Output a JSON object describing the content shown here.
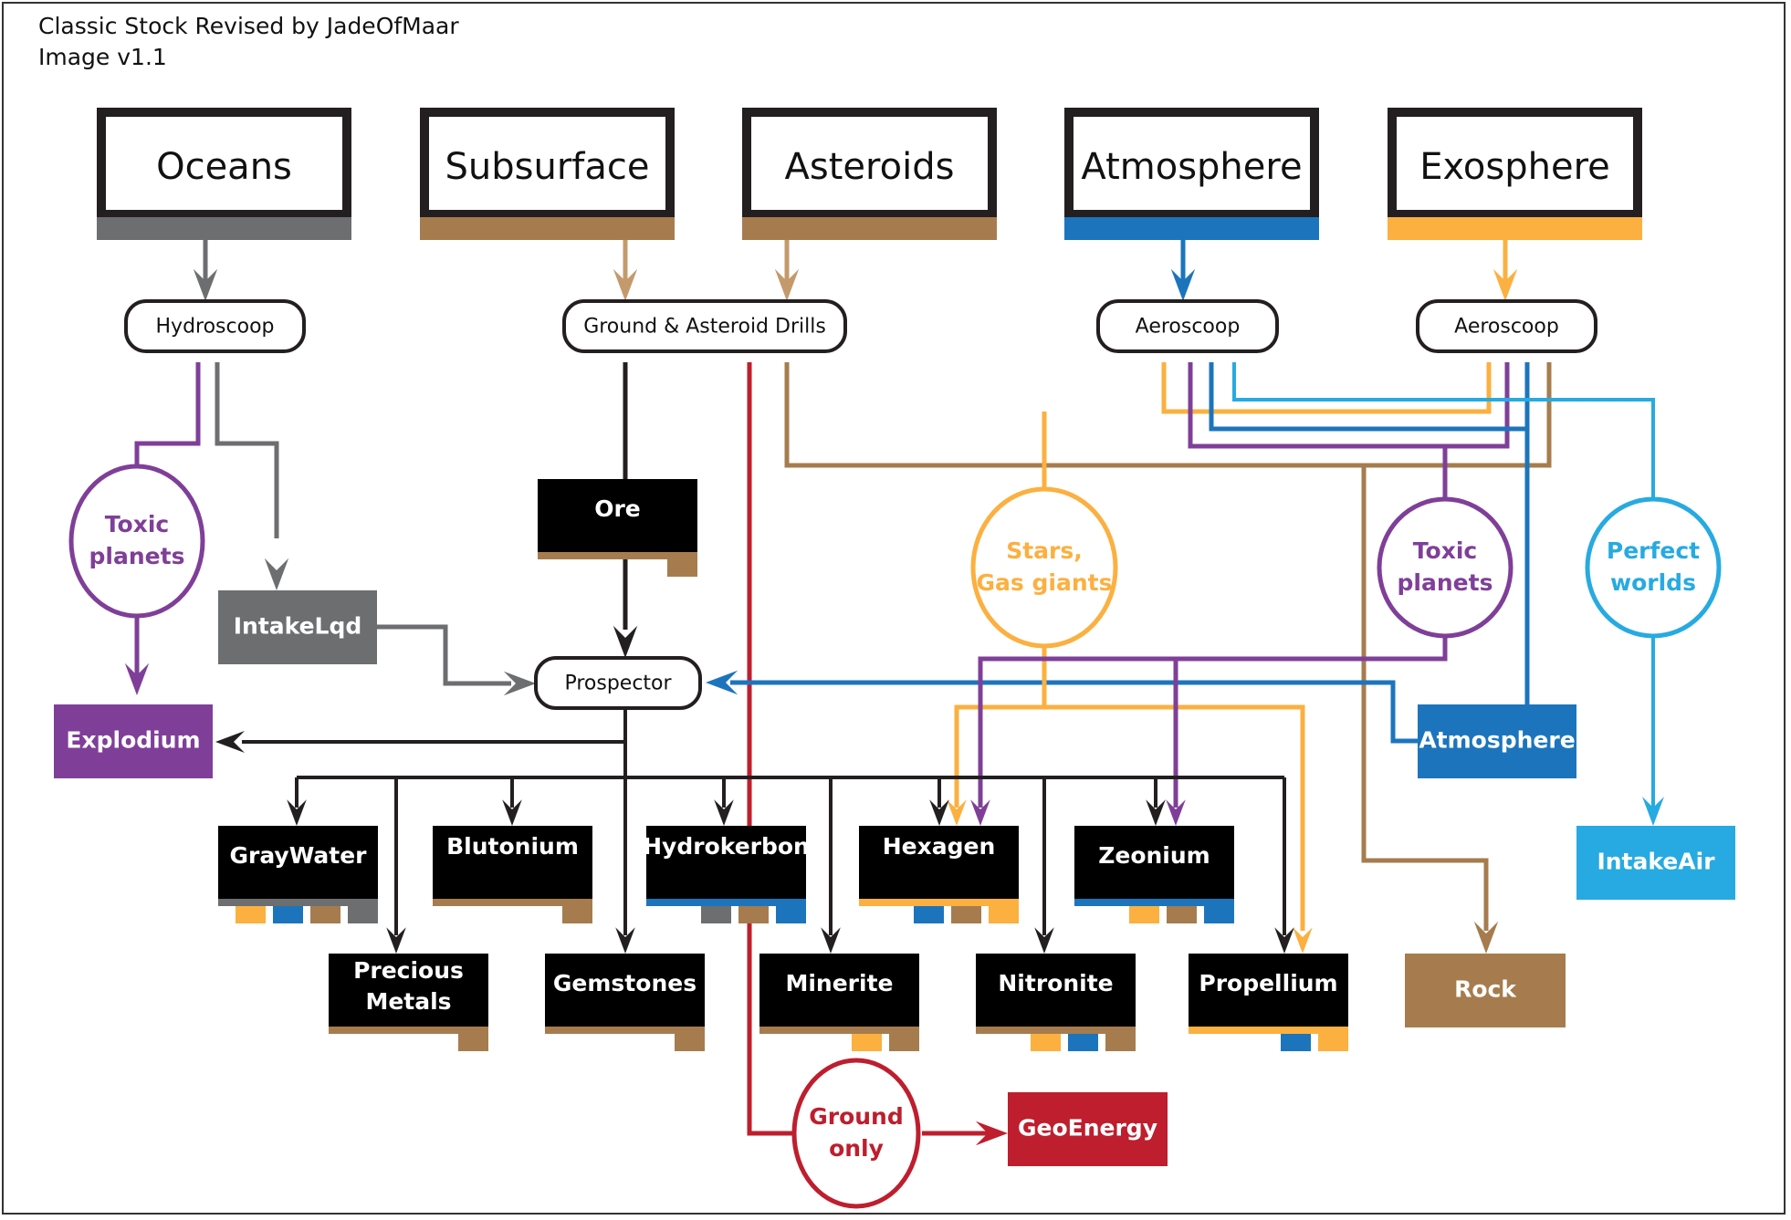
{
  "header": {
    "title": "Classic Stock Revised by JadeOfMaar",
    "version": "Image v1.1"
  },
  "colors": {
    "black": "#231f20",
    "gray": "#6d6e70",
    "brown": "#a67c4e",
    "arrow_brown": "#c49a6c",
    "blue": "#1c75bc",
    "orange": "#fbb040",
    "purple": "#7f3f98",
    "lightblue": "#27aae1",
    "red": "#be1e2d"
  },
  "sources": [
    {
      "id": "oceans",
      "label": "Oceans",
      "color": "gray"
    },
    {
      "id": "subsurface",
      "label": "Subsurface",
      "color": "brown"
    },
    {
      "id": "asteroids",
      "label": "Asteroids",
      "color": "brown"
    },
    {
      "id": "atmosphere",
      "label": "Atmosphere",
      "color": "blue"
    },
    {
      "id": "exosphere",
      "label": "Exosphere",
      "color": "orange"
    }
  ],
  "harvesters": [
    {
      "id": "hydroscoop",
      "label": "Hydroscoop"
    },
    {
      "id": "drills",
      "label": "Ground & Asteroid Drills"
    },
    {
      "id": "aeroscoop1",
      "label": "Aeroscoop"
    },
    {
      "id": "aeroscoop2",
      "label": "Aeroscoop"
    },
    {
      "id": "prospector",
      "label": "Prospector"
    }
  ],
  "conditions": [
    {
      "id": "toxic_left",
      "lines": [
        "Toxic",
        "planets"
      ],
      "color": "purple"
    },
    {
      "id": "stars",
      "lines": [
        "Stars,",
        "Gas giants"
      ],
      "color": "orange"
    },
    {
      "id": "toxic_right",
      "lines": [
        "Toxic",
        "planets"
      ],
      "color": "purple"
    },
    {
      "id": "perfect",
      "lines": [
        "Perfect",
        "worlds"
      ],
      "color": "lightblue"
    },
    {
      "id": "ground_only",
      "lines": [
        "Ground",
        "only"
      ],
      "color": "red"
    }
  ],
  "solid_resources": [
    {
      "id": "intakelqd",
      "label": "IntakeLqd",
      "color": "gray"
    },
    {
      "id": "explodium",
      "label": "Explodium",
      "color": "purple"
    },
    {
      "id": "atmosphere_res",
      "label": "Atmosphere",
      "color": "blue"
    },
    {
      "id": "intakeair",
      "label": "IntakeAir",
      "color": "lightblue"
    },
    {
      "id": "rock",
      "label": "Rock",
      "color": "brown"
    },
    {
      "id": "geoenergy",
      "label": "GeoEnergy",
      "color": "red"
    }
  ],
  "materials": [
    {
      "id": "ore",
      "lines": [
        "Ore"
      ],
      "bar": "brown",
      "chips": [
        "brown"
      ]
    },
    {
      "id": "graywater",
      "lines": [
        "GrayWater"
      ],
      "bar": "gray",
      "chips": [
        "orange",
        "blue",
        "brown",
        "gray"
      ]
    },
    {
      "id": "blutonium",
      "lines": [
        "Blutonium"
      ],
      "bar": "brown",
      "chips": [
        "brown"
      ]
    },
    {
      "id": "hydrokerbon",
      "lines": [
        "Hydrokerbon"
      ],
      "bar": "blue",
      "chips": [
        "gray",
        "brown",
        "blue"
      ]
    },
    {
      "id": "hexagen",
      "lines": [
        "Hexagen"
      ],
      "bar": "orange",
      "chips": [
        "blue",
        "brown",
        "orange"
      ]
    },
    {
      "id": "zeonium",
      "lines": [
        "Zeonium"
      ],
      "bar": "blue",
      "chips": [
        "orange",
        "brown",
        "blue"
      ]
    },
    {
      "id": "precious",
      "lines": [
        "Precious",
        "Metals"
      ],
      "bar": "brown",
      "chips": [
        "brown"
      ]
    },
    {
      "id": "gemstones",
      "lines": [
        "Gemstones"
      ],
      "bar": "brown",
      "chips": [
        "brown"
      ]
    },
    {
      "id": "minerite",
      "lines": [
        "Minerite"
      ],
      "bar": "brown",
      "chips": [
        "orange",
        "brown"
      ]
    },
    {
      "id": "nitronite",
      "lines": [
        "Nitronite"
      ],
      "bar": "brown",
      "chips": [
        "orange",
        "blue",
        "brown"
      ]
    },
    {
      "id": "propellium",
      "lines": [
        "Propellium"
      ],
      "bar": "orange",
      "chips": [
        "blue",
        "orange"
      ]
    }
  ],
  "flows": [
    {
      "from": "oceans",
      "to": "hydroscoop",
      "color": "gray"
    },
    {
      "from": "subsurface",
      "to": "drills",
      "color": "brown"
    },
    {
      "from": "asteroids",
      "to": "drills",
      "color": "brown"
    },
    {
      "from": "atmosphere",
      "to": "aeroscoop1",
      "color": "blue"
    },
    {
      "from": "exosphere",
      "to": "aeroscoop2",
      "color": "orange"
    },
    {
      "from": "hydroscoop",
      "to": "toxic_left",
      "color": "purple"
    },
    {
      "from": "toxic_left",
      "to": "explodium",
      "color": "purple"
    },
    {
      "from": "hydroscoop",
      "to": "intakelqd",
      "color": "gray"
    },
    {
      "from": "intakelqd",
      "to": "prospector",
      "color": "gray"
    },
    {
      "from": "drills",
      "to": "ore",
      "color": "black"
    },
    {
      "from": "ore",
      "to": "prospector",
      "color": "black"
    },
    {
      "from": "drills",
      "to": "ground_only",
      "color": "red"
    },
    {
      "from": "ground_only",
      "to": "geoenergy",
      "color": "red"
    },
    {
      "from": "drills",
      "to": "rock",
      "color": "brown"
    },
    {
      "from": "aeroscoop2",
      "to": "rock",
      "color": "brown"
    },
    {
      "from": "aeroscoop1",
      "to": "stars",
      "color": "orange"
    },
    {
      "from": "aeroscoop2",
      "to": "stars",
      "color": "orange"
    },
    {
      "from": "aeroscoop1",
      "to": "toxic_right",
      "color": "purple"
    },
    {
      "from": "aeroscoop2",
      "to": "toxic_right",
      "color": "purple"
    },
    {
      "from": "aeroscoop1",
      "to": "atmosphere_res",
      "color": "blue"
    },
    {
      "from": "aeroscoop2",
      "to": "atmosphere_res",
      "color": "blue"
    },
    {
      "from": "aeroscoop1",
      "to": "perfect",
      "color": "lightblue"
    },
    {
      "from": "perfect",
      "to": "intakeair",
      "color": "lightblue"
    },
    {
      "from": "atmosphere_res",
      "to": "prospector",
      "color": "blue"
    },
    {
      "from": "stars",
      "to": "hexagen",
      "color": "orange"
    },
    {
      "from": "stars",
      "to": "propellium",
      "color": "orange"
    },
    {
      "from": "toxic_right",
      "to": "hexagen",
      "color": "purple"
    },
    {
      "from": "toxic_right",
      "to": "zeonium",
      "color": "purple"
    },
    {
      "from": "prospector",
      "to": "explodium",
      "color": "black"
    },
    {
      "from": "prospector",
      "to": "graywater",
      "color": "black"
    },
    {
      "from": "prospector",
      "to": "precious",
      "color": "black"
    },
    {
      "from": "prospector",
      "to": "blutonium",
      "color": "black"
    },
    {
      "from": "prospector",
      "to": "gemstones",
      "color": "black"
    },
    {
      "from": "prospector",
      "to": "hydrokerbon",
      "color": "black"
    },
    {
      "from": "prospector",
      "to": "minerite",
      "color": "black"
    },
    {
      "from": "prospector",
      "to": "hexagen",
      "color": "black"
    },
    {
      "from": "prospector",
      "to": "nitronite",
      "color": "black"
    },
    {
      "from": "prospector",
      "to": "zeonium",
      "color": "black"
    },
    {
      "from": "prospector",
      "to": "propellium",
      "color": "black"
    }
  ]
}
